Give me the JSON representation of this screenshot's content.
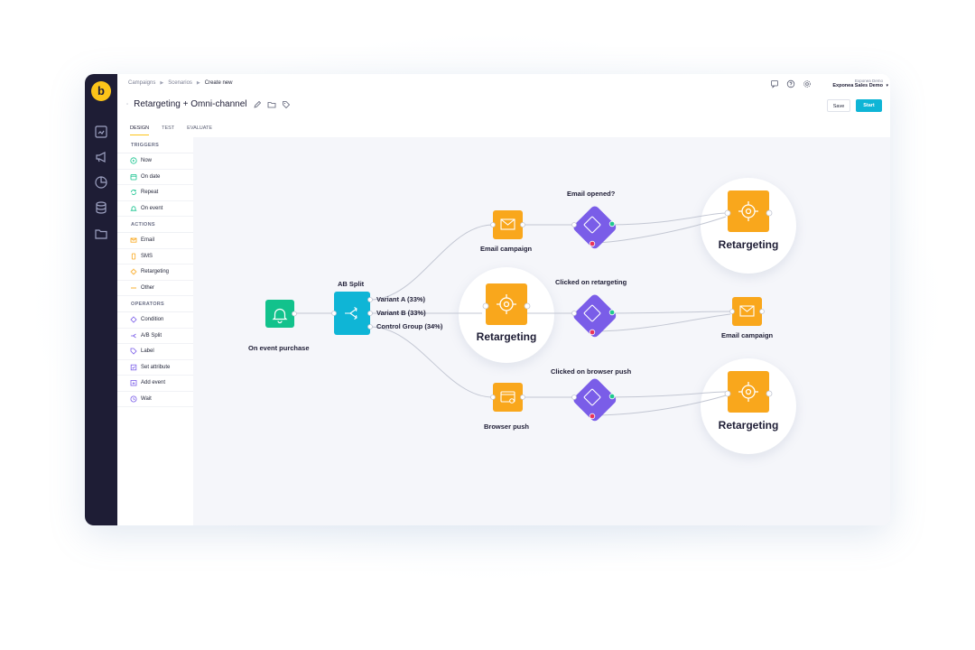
{
  "app": {
    "logo_glyph": "b"
  },
  "breadcrumb": {
    "items": [
      "Campaigns",
      "Scenarios",
      "Create new"
    ]
  },
  "scenario": {
    "title": "Retargeting + Omni-channel"
  },
  "tabs": [
    "DESIGN",
    "TEST",
    "EVALUATE"
  ],
  "user": {
    "org": "Exponea Demo",
    "name": "Exponea Sales Demo"
  },
  "buttons": {
    "save": "Save",
    "start": "Start"
  },
  "sidebar": {
    "triggers": {
      "heading": "TRIGGERS",
      "items": [
        "Now",
        "On date",
        "Repeat",
        "On event"
      ]
    },
    "actions": {
      "heading": "ACTIONS",
      "items": [
        "Email",
        "SMS",
        "Retargeting",
        "Other"
      ]
    },
    "operators": {
      "heading": "OPERATORS",
      "items": [
        "Condition",
        "A/B Split",
        "Label",
        "Set attribute",
        "Add event",
        "Wait"
      ]
    }
  },
  "flow": {
    "trigger_label": "On event purchase",
    "split_label": "AB Split",
    "variants": [
      "Variant A (33%)",
      "Variant B (33%)",
      "Control Group (34%)"
    ],
    "email_campaign_top": "Email campaign",
    "condition_top": "Email opened?",
    "retargeting_top": "Retargeting",
    "retargeting_mid": "Retargeting",
    "condition_mid": "Clicked on retargeting",
    "email_campaign_mid": "Email campaign",
    "browser_push": "Browser push",
    "condition_bottom": "Clicked on browser push",
    "retargeting_bottom": "Retargeting"
  },
  "colors": {
    "rail": "#1e1d35",
    "accent_yellow": "#fcc419",
    "start_button": "#0fb5d6",
    "trigger_node": "#12c28c",
    "split_node": "#0fb5d6",
    "action_node": "#f9a71c",
    "condition_node": "#7a5de8"
  }
}
